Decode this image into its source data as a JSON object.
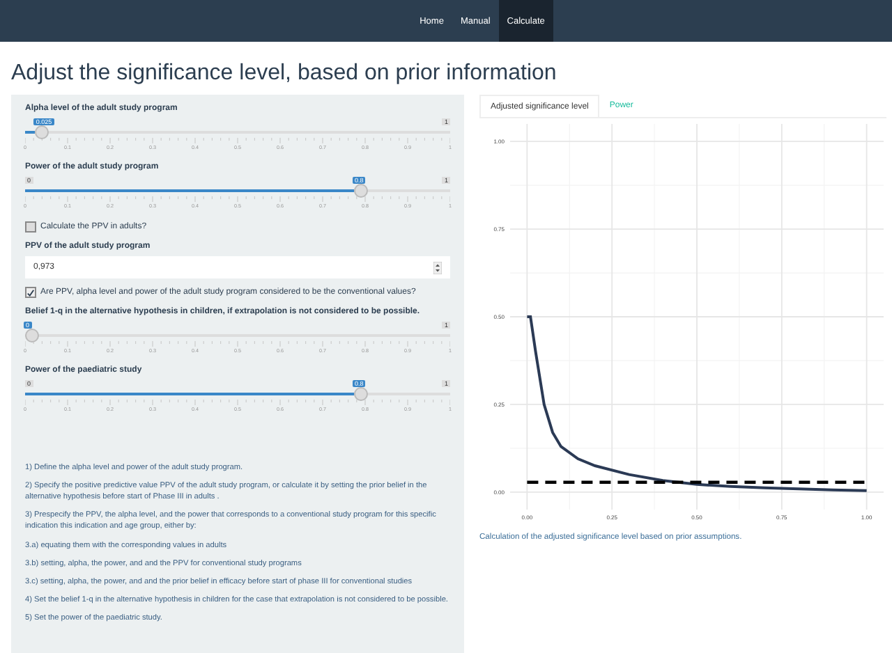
{
  "navbar": {
    "items": [
      {
        "label": "Home",
        "selected": false
      },
      {
        "label": "Manual",
        "selected": false
      },
      {
        "label": "Calculate",
        "selected": true
      }
    ]
  },
  "title": "Adjust the significance level, based on prior information",
  "inputs": [
    {
      "kind": "slider",
      "label": "Alpha level of the adult study program",
      "value": "0.025",
      "level": 0.025,
      "max": "1",
      "ticks": [
        "0",
        "0.1",
        "0.2",
        "0.3",
        "0.4",
        "0.5",
        "0.6",
        "0.7",
        "0.8",
        "0.9",
        "1"
      ]
    },
    {
      "kind": "slider",
      "label": "Power of the adult study program",
      "value": "0.8",
      "level": 0.8,
      "min": "0",
      "max": "1",
      "ticks": [
        "0",
        "0.1",
        "0.2",
        "0.3",
        "0.4",
        "0.5",
        "0.6",
        "0.7",
        "0.8",
        "0.9",
        "1"
      ]
    },
    {
      "kind": "checkbox",
      "label": "Calculate the PPV in adults?",
      "checked": false
    },
    {
      "kind": "number",
      "label": "PPV of the adult study program",
      "value": "0,973"
    },
    {
      "kind": "checkbox",
      "label": "Are PPV, alpha level and power of the adult study program considered to be the conventional values?",
      "checked": true
    },
    {
      "kind": "slider",
      "label": "Belief 1-q in the alternative hypothesis in children, if extrapolation is not considered to be possible.",
      "value": "0",
      "level": 0,
      "max": "1",
      "ticks": [
        "0",
        "0.1",
        "0.2",
        "0.3",
        "0.4",
        "0.5",
        "0.6",
        "0.7",
        "0.8",
        "0.9",
        "1"
      ]
    },
    {
      "kind": "slider",
      "label": "Power of the paediatric study",
      "value": "0.8",
      "level": 0.8,
      "min": "0",
      "max": "1",
      "ticks": [
        "0",
        "0.1",
        "0.2",
        "0.3",
        "0.4",
        "0.5",
        "0.6",
        "0.7",
        "0.8",
        "0.9",
        "1"
      ]
    }
  ],
  "instructions": [
    "1) Define the alpha level and power of the adult study program.",
    "2) Specify the positive predictive value PPV of the adult study program, or calculate it by setting the prior belief in the alternative hypothesis before start of Phase III in adults .",
    "3) Prespecify the PPV, the alpha level, and the power that corresponds to a conventional study program for this specific indication this indication and age group, either by:",
    "3.a) equating them with the corresponding values in adults",
    "3.b) setting, alpha, the power, and and the PPV for conventional study programs",
    "3.c) setting, alpha, the power, and and the prior belief in efficacy before start of phase III for conventional studies",
    "4) Set the belief 1-q in the alternative hypothesis in children for the case that extrapolation is not considered to be possible.",
    "5) Set the power of the paediatric study."
  ],
  "tabs": [
    {
      "label": "Adjusted significance level",
      "selected": true
    },
    {
      "label": "Power",
      "selected": false
    }
  ],
  "chart_data": {
    "type": "line",
    "x": [
      0,
      0.01,
      0.025,
      0.05,
      0.075,
      0.1,
      0.15,
      0.2,
      0.3,
      0.4,
      0.5,
      0.6,
      0.7,
      0.8,
      0.9,
      1
    ],
    "grid": true,
    "series": [
      {
        "color": "#2b3a55",
        "line_style": "solid",
        "values": [
          0.5,
          0.5,
          0.4,
          0.25,
          0.17,
          0.13,
          0.095,
          0.075,
          0.05,
          0.033,
          0.022,
          0.016,
          0.012,
          0.009,
          0.006,
          0.004
        ]
      },
      {
        "color": "#000000",
        "line_style": "dashed",
        "values": [
          0.028,
          0.028,
          0.028,
          0.028,
          0.028,
          0.028,
          0.028,
          0.028,
          0.028,
          0.028,
          0.028,
          0.028,
          0.028,
          0.028,
          0.028,
          0.028
        ]
      }
    ],
    "xlim": [
      -0.05,
      1.05
    ],
    "ylim": [
      -0.05,
      1.05
    ],
    "xticks": [
      {
        "value": 0,
        "label": "0.00"
      },
      {
        "value": 0.25,
        "label": "0.25"
      },
      {
        "value": 0.5,
        "label": "0.50"
      },
      {
        "value": 0.75,
        "label": "0.75"
      },
      {
        "value": 1,
        "label": "1.00"
      }
    ],
    "yticks": [
      {
        "value": 0,
        "label": "0.00"
      },
      {
        "value": 0.25,
        "label": "0.25"
      },
      {
        "value": 0.5,
        "label": "0.50"
      },
      {
        "value": 0.75,
        "label": "0.75"
      },
      {
        "value": 1,
        "label": "1.00"
      }
    ]
  },
  "caption": "Calculation of the adjusted significance level based on prior assumptions."
}
